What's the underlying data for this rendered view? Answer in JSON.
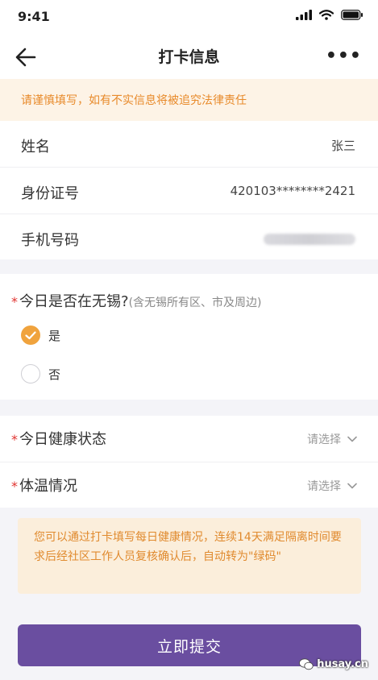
{
  "status_bar": {
    "time": "9:41"
  },
  "navbar": {
    "title": "打卡信息",
    "more": "•••"
  },
  "warning": {
    "text": "请谨慎填写，如有不实信息将被追究法律责任"
  },
  "info": [
    {
      "label": "姓名",
      "value": "张三"
    },
    {
      "label": "身份证号",
      "value": "420103********2421"
    },
    {
      "label": "手机号码",
      "value": ""
    }
  ],
  "question": {
    "required_mark": "*",
    "title": "今日是否在无锡?",
    "note": "(含无锡所有区、市及周边)",
    "options": [
      {
        "label": "是",
        "checked": true
      },
      {
        "label": "否",
        "checked": false
      }
    ]
  },
  "selects": [
    {
      "required_mark": "*",
      "label": "今日健康状态",
      "placeholder": "请选择"
    },
    {
      "required_mark": "*",
      "label": "体温情况",
      "placeholder": "请选择"
    }
  ],
  "notice": {
    "text": "您可以通过打卡填写每日健康情况，连续14天满足隔离时间要求后经社区工作人员复核确认后，自动转为\"绿码\""
  },
  "submit": {
    "label": "立即提交"
  },
  "watermark": {
    "text": "husay.cn"
  },
  "colors": {
    "accent": "#6a4ea0",
    "warning": "#e88a2a",
    "radio_checked": "#f0a33d",
    "required": "#e0332f"
  }
}
